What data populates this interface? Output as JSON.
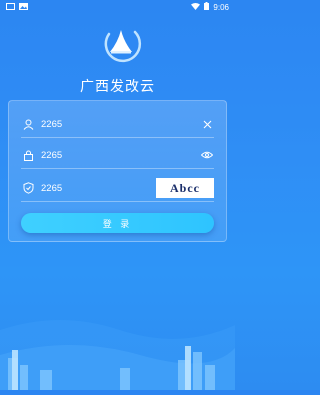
{
  "status_bar": {
    "time": "9:06"
  },
  "app": {
    "title": "广西发改云"
  },
  "form": {
    "username": {
      "value": "2265"
    },
    "password": {
      "value": "2265"
    },
    "captcha": {
      "value": "2265",
      "code": "Abcc"
    },
    "login_label": "登 录"
  },
  "colors": {
    "bg": "#2f8ef5",
    "button": "#3fd0ff"
  }
}
